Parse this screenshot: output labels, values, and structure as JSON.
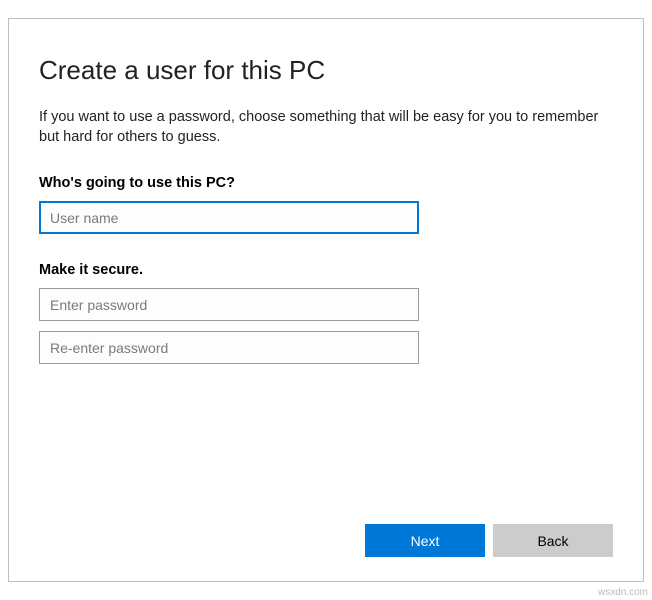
{
  "dialog": {
    "title": "Create a user for this PC",
    "subtitle": "If you want to use a password, choose something that will be easy for you to remember but hard for others to guess.",
    "section_user_label": "Who's going to use this PC?",
    "username_placeholder": "User name",
    "username_value": "",
    "section_secure_label": "Make it secure.",
    "password_placeholder": "Enter password",
    "password_value": "",
    "password_confirm_placeholder": "Re-enter password",
    "password_confirm_value": ""
  },
  "buttons": {
    "next": "Next",
    "back": "Back"
  },
  "watermark": "wsxdn.com"
}
